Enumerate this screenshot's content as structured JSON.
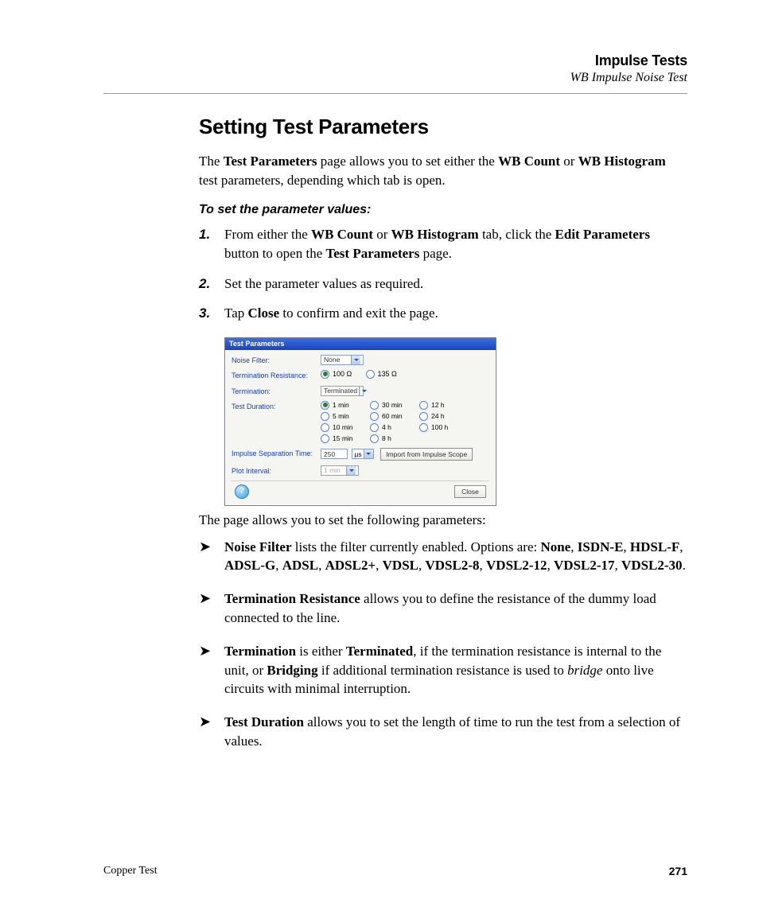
{
  "header": {
    "title": "Impulse Tests",
    "subtitle": "WB Impulse Noise Test"
  },
  "section_title": "Setting Test Parameters",
  "intro": {
    "pre": "The ",
    "b1": "Test Parameters",
    "mid1": " page allows you to set either the ",
    "b2": "WB Count",
    "mid2": " or ",
    "b3": "WB Histogram",
    "post": " test parameters, depending which tab is open."
  },
  "subhead": "To set the parameter values:",
  "steps": [
    {
      "num": "1.",
      "t0": "From either the ",
      "b0": "WB Count",
      "t1": " or ",
      "b1": "WB Histogram",
      "t2": " tab, click the ",
      "b2": "Edit Parameters",
      "t3": " button to open the ",
      "b3": "Test Parameters",
      "t4": " page."
    },
    {
      "num": "2.",
      "t0": "Set the parameter values as required."
    },
    {
      "num": "3.",
      "t0": "Tap ",
      "b0": "Close",
      "t1": " to confirm and exit the page."
    }
  ],
  "dialog": {
    "title": "Test Parameters",
    "noise_filter": {
      "label": "Noise Filter:",
      "value": "None"
    },
    "term_res": {
      "label": "Termination Resistance:",
      "opt1": "100 Ω",
      "opt2": "135 Ω",
      "selected": "opt1"
    },
    "termination": {
      "label": "Termination:",
      "value": "Terminated"
    },
    "duration": {
      "label": "Test Duration:",
      "options": [
        "1 min",
        "5 min",
        "10 min",
        "15 min",
        "30 min",
        "60 min",
        "4 h",
        "8 h",
        "12 h",
        "24 h",
        "100 h"
      ],
      "selected": "1 min"
    },
    "isep": {
      "label": "Impulse Separation Time:",
      "value": "250",
      "unit": "µs",
      "button": "Import from Impulse Scope"
    },
    "plot": {
      "label": "Plot Interval:",
      "value": "1 min"
    },
    "close": "Close",
    "help": "?"
  },
  "after_fig": "The page allows you to set the following parameters:",
  "bullets": [
    {
      "b0": "Noise Filter",
      "t0": " lists the filter currently enabled. Options are: ",
      "list": [
        "None",
        "ISDN-E",
        "HDSL-F",
        "ADSL-G",
        "ADSL",
        "ADSL2+",
        "VDSL",
        "VDSL2-8",
        "VDSL2-12",
        "VDSL2-17",
        "VDSL2-30"
      ],
      "period": "."
    },
    {
      "b0": "Termination Resistance",
      "t0": " allows you to define the resistance of the dummy load connected to the line."
    },
    {
      "b0": "Termination",
      "t0": " is either ",
      "b1": "Terminated",
      "t1": ", if the termination resistance is internal to the unit, or ",
      "b2": "Bridging",
      "t2": " if additional termination resistance is used to ",
      "i0": "bridge",
      "t3": " onto live circuits with minimal interruption."
    },
    {
      "b0": "Test Duration",
      "t0": " allows you to set the length of time to run the test from a selection of values."
    }
  ],
  "footer": {
    "left": "Copper Test",
    "right": "271"
  }
}
